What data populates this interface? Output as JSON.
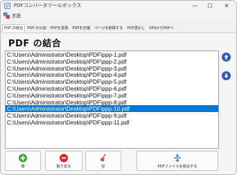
{
  "window": {
    "title": "PDFコンバータツールボックス"
  },
  "window_controls": {
    "minimize": "—",
    "maximize": "☐",
    "close": "✕"
  },
  "menu": {
    "language_label": "言語"
  },
  "tabs": [
    {
      "label": "PDF の結合",
      "active": true
    },
    {
      "label": "PDF の分割",
      "active": false
    },
    {
      "label": "PDFを変換",
      "active": false
    },
    {
      "label": "PDFを圧縮",
      "active": false
    },
    {
      "label": "ページを削除する",
      "active": false
    },
    {
      "label": "PDF透かし",
      "active": false
    },
    {
      "label": "XPSからPDFへ",
      "active": false
    }
  ],
  "page": {
    "title": "PDF の結合"
  },
  "files": [
    "C:\\Users\\Administrator\\Desktop\\PDF\\ppp-1.pdf",
    "C:\\Users\\Administrator\\Desktop\\PDF\\ppp-2.pdf",
    "C:\\Users\\Administrator\\Desktop\\PDF\\ppp-3.pdf",
    "C:\\Users\\Administrator\\Desktop\\PDF\\ppp-4.pdf",
    "C:\\Users\\Administrator\\Desktop\\PDF\\ppp-5.pdf",
    "C:\\Users\\Administrator\\Desktop\\PDF\\ppp-6.pdf",
    "C:\\Users\\Administrator\\Desktop\\PDF\\ppp-7.pdf",
    "C:\\Users\\Administrator\\Desktop\\PDF\\ppp-8.pdf",
    "C:\\Users\\Administrator\\Desktop\\PDF\\ppp-10.pdf",
    "C:\\Users\\Administrator\\Desktop\\PDF\\ppp-9.pdf",
    "C:\\Users\\Administrator\\Desktop\\PDF\\ppp-11.pdf"
  ],
  "selected_file_index": 8,
  "buttons": {
    "add": "増",
    "remove": "取り去る",
    "clear": "空",
    "merge": "PDFファイルを結合する"
  },
  "colors": {
    "selection": "#0078d7",
    "move_buttons": "#3957b8",
    "add_icon": "#3aa53a",
    "remove_icon": "#e02424",
    "merge_icon": "#2f6fd0"
  }
}
